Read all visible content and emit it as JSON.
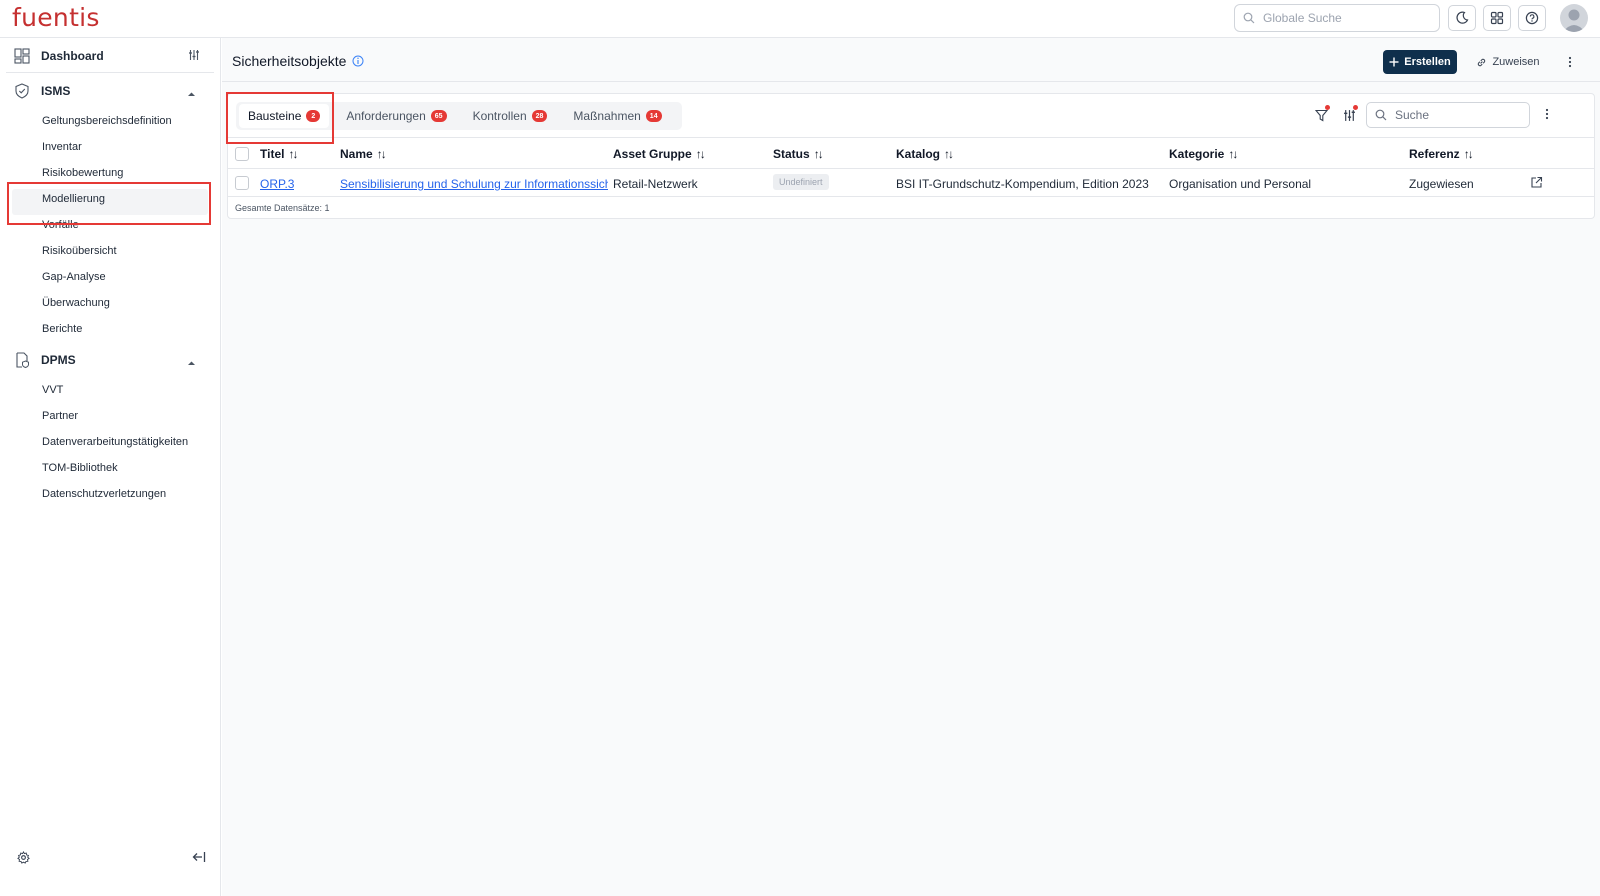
{
  "app": {
    "logo": "fuentis"
  },
  "topbar": {
    "search_placeholder": "Globale Suche",
    "icons": [
      "search-icon",
      "moon-icon",
      "grid-icon",
      "help-icon",
      "avatar-icon"
    ]
  },
  "sidebar": {
    "dashboard": "Dashboard",
    "isms": {
      "label": "ISMS",
      "items": [
        "Geltungsbereichsdefinition",
        "Inventar",
        "Risikobewertung",
        "Modellierung",
        "Vorfälle",
        "Risikoübersicht",
        "Gap-Analyse",
        "Überwachung",
        "Berichte"
      ]
    },
    "dpms": {
      "label": "DPMS",
      "items": [
        "VVT",
        "Partner",
        "Datenverarbeitungstätigkeiten",
        "TOM-Bibliothek",
        "Datenschutzverletzungen"
      ]
    },
    "active_item": "Modellierung"
  },
  "page": {
    "title": "Sicherheitsobjekte",
    "create_label": "Erstellen",
    "assign_label": "Zuweisen"
  },
  "tabs": [
    {
      "label": "Bausteine",
      "count": "2"
    },
    {
      "label": "Anforderungen",
      "count": "65"
    },
    {
      "label": "Kontrollen",
      "count": "28"
    },
    {
      "label": "Maßnahmen",
      "count": "14"
    }
  ],
  "table": {
    "search_placeholder": "Suche",
    "columns": [
      "Titel",
      "Name",
      "Asset Gruppe",
      "Status",
      "Katalog",
      "Kategorie",
      "Referenz"
    ],
    "rows": [
      {
        "titel": "ORP.3",
        "name": "Sensibilisierung und Schulung zur Informationssicherheit",
        "asset_gruppe": "Retail-Netzwerk",
        "status": "Undefiniert",
        "katalog": "BSI IT-Grundschutz-Kompendium, Edition 2023",
        "kategorie": "Organisation und Personal",
        "referenz": "Zugewiesen"
      }
    ],
    "footer": "Gesamte Datensätze: 1"
  },
  "colors": {
    "brand": "#c53030",
    "primary_button": "#0f2f4c",
    "badge": "#e53935",
    "link": "#2563eb",
    "highlight": "#e53935"
  }
}
